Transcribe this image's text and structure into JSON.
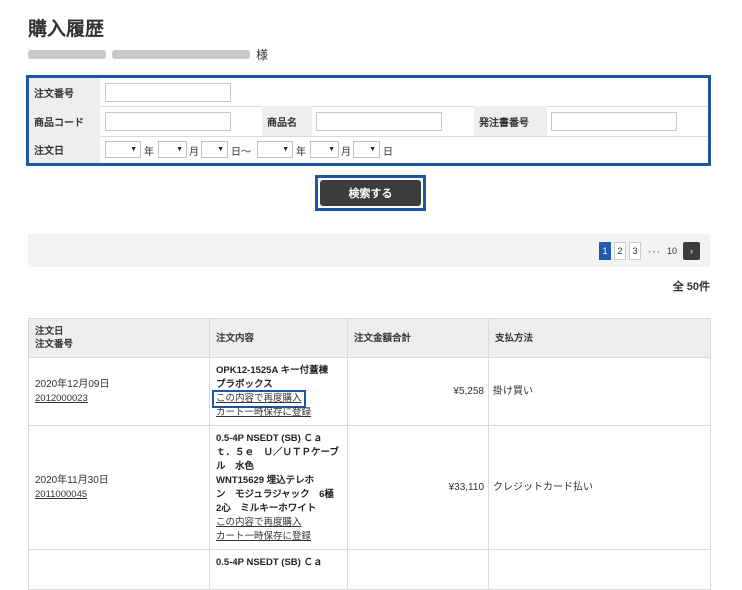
{
  "page": {
    "title": "購入履歴"
  },
  "customer": {
    "honorific": "様"
  },
  "search": {
    "order_number_label": "注文番号",
    "product_code_label": "商品コード",
    "product_name_label": "商品名",
    "po_number_label": "発注書番号",
    "order_date_label": "注文日",
    "year_unit": "年",
    "month_unit": "月",
    "day_unit": "日",
    "range_sep": "日～",
    "select_arrow": "▼",
    "button_label": "検索する"
  },
  "pagination": {
    "pages": [
      "1",
      "2",
      "3"
    ],
    "ellipsis": "･･･",
    "last_page": "10",
    "next": "›",
    "active_page": "1"
  },
  "total": {
    "label": "全 50件"
  },
  "table": {
    "headers": {
      "date": "注文日",
      "number": "注文番号",
      "contents": "注文内容",
      "amount": "注文金額合計",
      "payment": "支払方法"
    },
    "rows": [
      {
        "date": "2020年12月09日",
        "order_number": "2012000023",
        "products": [
          "OPK12-1525A キー付蓋棟",
          "プラボックス"
        ],
        "reorder_link": "この内容で再度購入",
        "cart_link": "カート一時保存に登録",
        "amount": "¥5,258",
        "payment": "掛け買い"
      },
      {
        "date": "2020年11月30日",
        "order_number": "2011000045",
        "products": [
          "0.5-4P NSEDT (SB) Ｃａ",
          "ｔ．５ｅ　Ｕ／ＵＴＰケーブ",
          "ル　水色",
          "WNT15629 埋込テレホ",
          "ン　モジュラジャック　6極",
          "2心　ミルキーホワイト"
        ],
        "reorder_link": "この内容で再度購入",
        "cart_link": "カート一時保存に登録",
        "amount": "¥33,110",
        "payment": "クレジットカード払い"
      },
      {
        "products": [
          "0.5-4P NSEDT (SB) Ｃａ"
        ]
      }
    ]
  },
  "colors": {
    "highlight": "#1e56a6",
    "button": "#3c3c3c",
    "active_page": "#1f5dab"
  }
}
